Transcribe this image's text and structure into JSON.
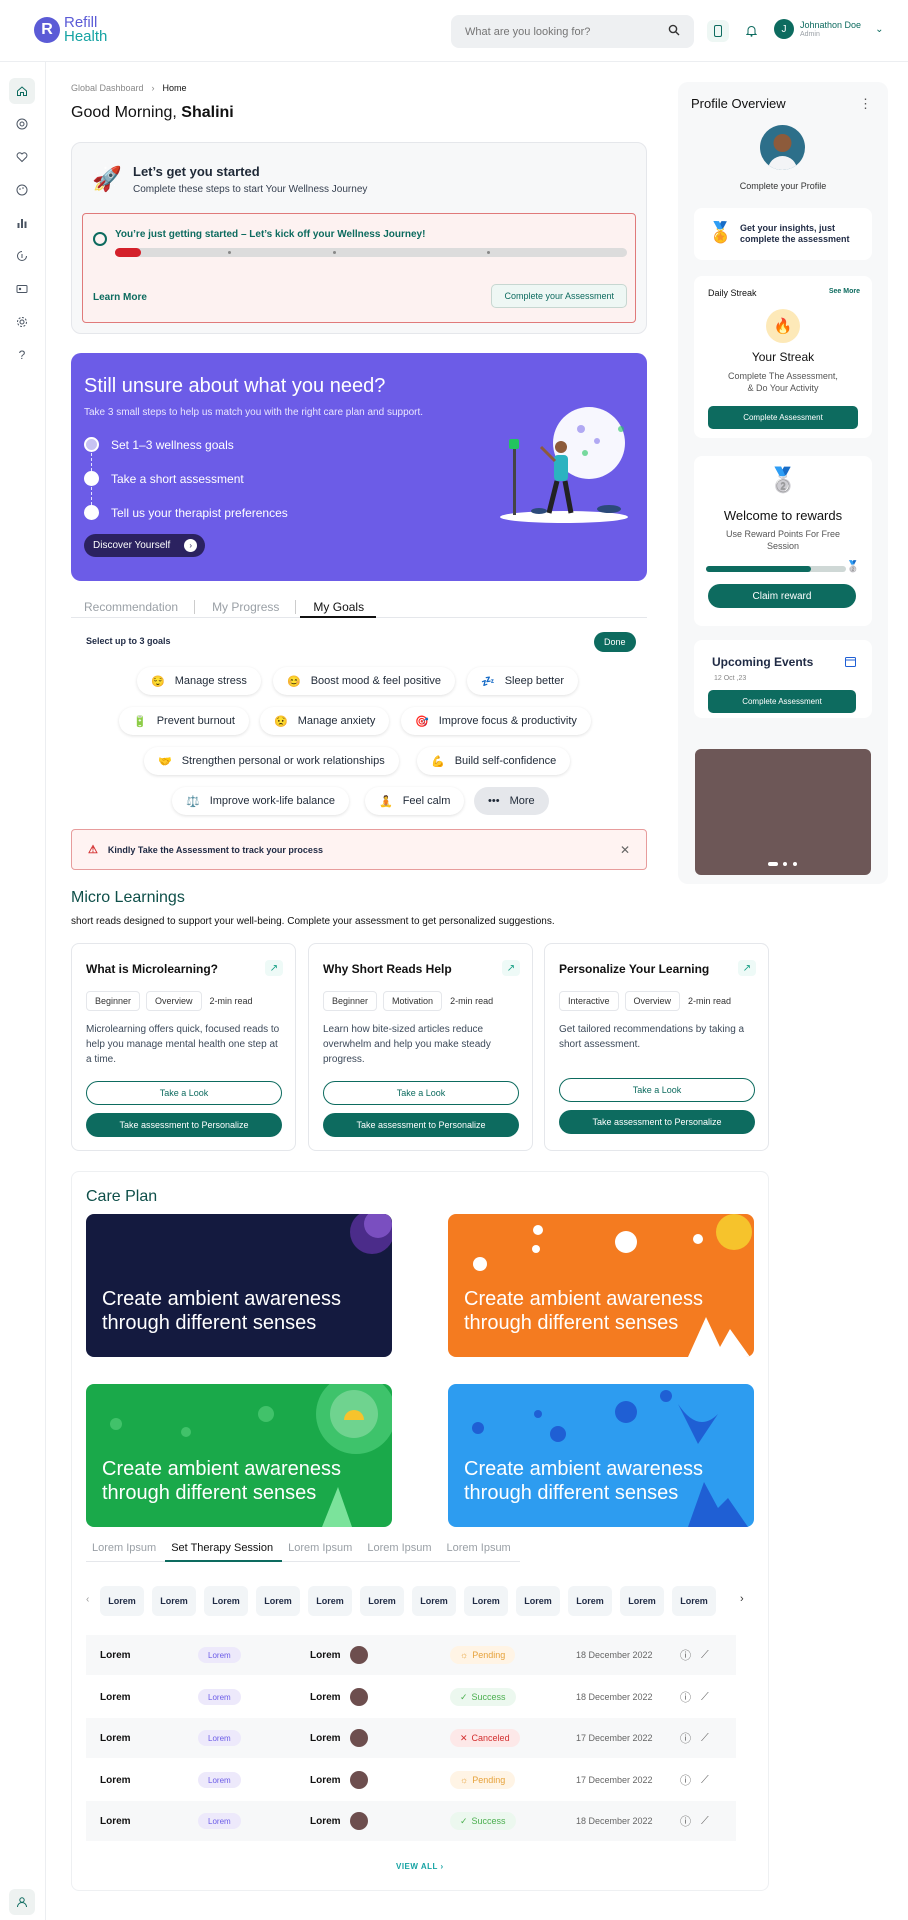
{
  "header": {
    "logo_line1": "Refill",
    "logo_line2": "Health",
    "search_placeholder": "What are you looking for?",
    "user_initial": "J",
    "user_name": "Johnathon Doe",
    "user_role": "Admin"
  },
  "breadcrumb": {
    "root": "Global Dashboard",
    "current": "Home"
  },
  "greeting": {
    "prefix": "Good Morning,",
    "name": "Shalini"
  },
  "start_card": {
    "title": "Let’s get you started",
    "subtitle": "Complete these steps to start Your Wellness Journey",
    "progress_text": "You’re just getting started – Let’s kick off your Wellness Journey!",
    "progress_fraction": 0.05,
    "learn_more": "Learn More",
    "cta": "Complete  your Assessment"
  },
  "unsure": {
    "title": "Still unsure about what you need?",
    "subtitle": "Take 3 small steps to help us match you with the right care plan and support.",
    "steps": [
      "Set 1–3 wellness goals",
      "Take a short assessment",
      "Tell us your therapist preferences"
    ],
    "cta": "Discover Yourself"
  },
  "tabs": [
    "Recommendation",
    "My Progress",
    "My Goals"
  ],
  "goals": {
    "note": "Select up to 3 goals",
    "done": "Done",
    "chips": [
      {
        "emoji": "😌",
        "label": "Manage stress"
      },
      {
        "emoji": "😊",
        "label": "Boost mood & feel positive"
      },
      {
        "emoji": "💤",
        "label": "Sleep better"
      },
      {
        "emoji": "🔋",
        "label": "Prevent burnout"
      },
      {
        "emoji": "😟",
        "label": "Manage anxiety"
      },
      {
        "emoji": "🎯",
        "label": "Improve focus & productivity"
      },
      {
        "emoji": "🤝",
        "label": "Strengthen personal or work relationships"
      },
      {
        "emoji": "💪",
        "label": "Build self-confidence"
      },
      {
        "emoji": "⚖️",
        "label": "Improve work-life balance"
      },
      {
        "emoji": "🧘",
        "label": "Feel calm"
      },
      {
        "emoji": "•••",
        "label": "More"
      }
    ]
  },
  "alert": {
    "text": "Kindly Take  the Assessment to track your process"
  },
  "micro": {
    "title": "Micro Learnings",
    "subtitle": "short reads designed to support your well-being. Complete your assessment to get personalized suggestions.",
    "cards": [
      {
        "title": "What is Microlearning?",
        "tags": [
          "Beginner",
          "Overview",
          "2-min read"
        ],
        "desc": "Microlearning offers quick, focused reads to help you manage mental health one step at a time.",
        "look": "Take a Look",
        "assess": "Take assessment to Personalize"
      },
      {
        "title": "Why Short Reads Help",
        "tags": [
          "Beginner",
          "Motivation",
          "2-min read"
        ],
        "desc": "Learn how bite-sized articles reduce overwhelm and help you make steady progress.",
        "look": "Take a Look",
        "assess": "Take assessment to Personalize"
      },
      {
        "title": "Personalize Your Learning",
        "tags": [
          "Interactive",
          "Overview",
          "2-min read"
        ],
        "desc": "Get tailored recommendations by taking a short assessment.",
        "look": "Take a Look",
        "assess": "Take assessment to Personalize"
      }
    ]
  },
  "care_plan": {
    "title": "Care Plan",
    "tiles": [
      {
        "text": "Create ambient awareness through different senses",
        "bg": "#141a3f"
      },
      {
        "text": "Create ambient awareness through different senses",
        "bg": "#f47b20"
      },
      {
        "text": "Create ambient awareness through different senses",
        "bg": "#1aa94a"
      },
      {
        "text": "Create ambient awareness through different senses",
        "bg": "#2d9cf0"
      }
    ],
    "tabs": [
      "Lorem Ipsum",
      "Set Therapy Session",
      "Lorem Ipsum",
      "Lorem Ipsum",
      "Lorem Ipsum"
    ],
    "pills": [
      "Lorem",
      "Lorem",
      "Lorem",
      "Lorem",
      "Lorem",
      "Lorem",
      "Lorem",
      "Lorem",
      "Lorem",
      "Lorem",
      "Lorem",
      "Lorem"
    ],
    "rows": [
      {
        "a": "Lorem",
        "b": "Lorem",
        "c": "Lorem",
        "status": "Pending",
        "date": "18 December 2022"
      },
      {
        "a": "Lorem",
        "b": "Lorem",
        "c": "Lorem",
        "status": "Success",
        "date": "18 December 2022"
      },
      {
        "a": "Lorem",
        "b": "Lorem",
        "c": "Lorem",
        "status": "Canceled",
        "date": "17 December 2022"
      },
      {
        "a": "Lorem",
        "b": "Lorem",
        "c": "Lorem",
        "status": "Pending",
        "date": "17 December 2022"
      },
      {
        "a": "Lorem",
        "b": "Lorem",
        "c": "Lorem",
        "status": "Success",
        "date": "18 December 2022"
      }
    ],
    "view_all": "VIEW ALL  ›"
  },
  "profile": {
    "title": "Profile Overview",
    "complete": "Complete your Profile",
    "insight": "Get your insights, just complete the assessment",
    "streak_label": "Daily Streak",
    "see_more": "See More",
    "streak_title": "Your Streak",
    "streak_sub": "Complete The Assessment, & Do Your Activity",
    "streak_cta": "Complete Assessment",
    "rewards_title": "Welcome to rewards",
    "rewards_sub": "Use Reward Points For Free Session",
    "rewards_progress": 0.75,
    "rewards_cta": "Claim reward",
    "events_title": "Upcoming Events",
    "events_date": "12 Oct ,23",
    "events_cta": "Complete Assessment"
  }
}
